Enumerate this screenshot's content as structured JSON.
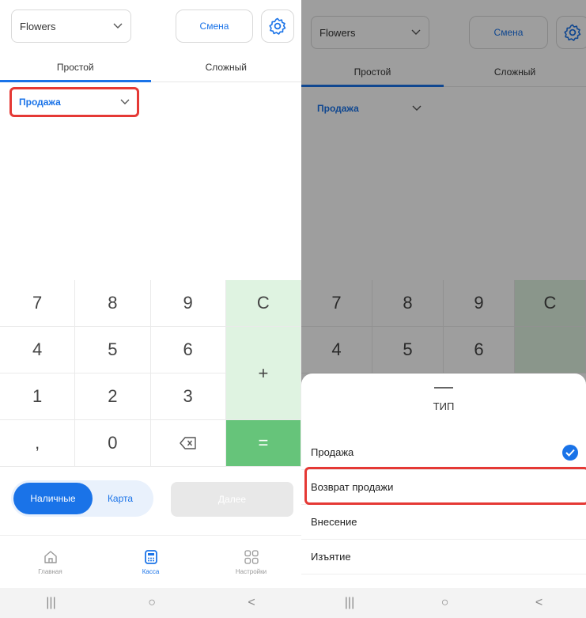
{
  "left": {
    "store_select": "Flowers",
    "shift_button": "Смена",
    "tabs": [
      "Простой",
      "Сложный"
    ],
    "operation_type": "Продажа",
    "keypad": {
      "digits": [
        "7",
        "8",
        "9",
        "4",
        "5",
        "6",
        "1",
        "2",
        "3",
        ",",
        "0"
      ],
      "clear": "C",
      "plus": "+",
      "equals": "="
    },
    "payment": {
      "cash": "Наличные",
      "card": "Карта",
      "next": "Далее"
    },
    "nav": [
      "Главная",
      "Касса",
      "Настройки"
    ]
  },
  "right": {
    "store_select": "Flowers",
    "shift_button": "Смена",
    "tabs": [
      "Простой",
      "Сложный"
    ],
    "operation_type": "Продажа",
    "keypad": {
      "digits": [
        "7",
        "8",
        "9",
        "4",
        "5",
        "6"
      ],
      "clear": "C"
    },
    "sheet": {
      "title": "ТИП",
      "items": [
        "Продажа",
        "Возврат продажи",
        "Внесение",
        "Изъятие"
      ]
    }
  },
  "system_nav": [
    "|||",
    "○",
    "<"
  ],
  "colors": {
    "accent": "#1a73e8",
    "highlight": "#e53935",
    "key_green": "#66c47a",
    "key_green_light": "#dff3e1"
  }
}
